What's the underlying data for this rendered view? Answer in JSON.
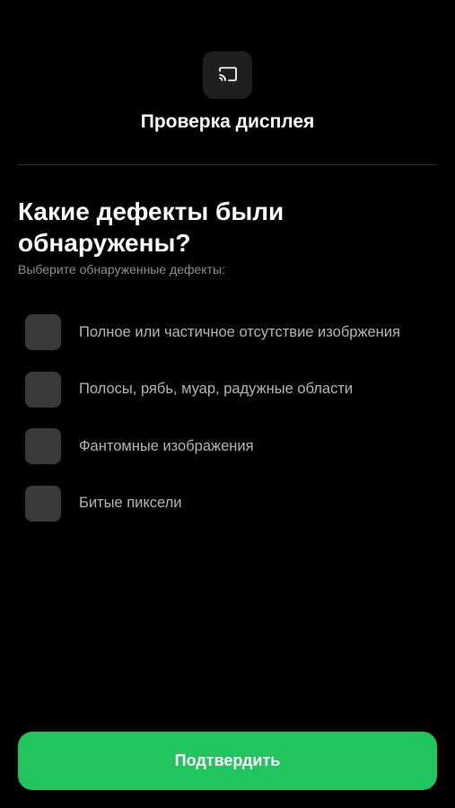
{
  "header": {
    "icon": "cast-screen-icon",
    "title": "Проверка дисплея"
  },
  "question": {
    "title": "Какие дефекты были обнаружены?",
    "subtitle": "Выберите обнаруженные дефекты:"
  },
  "options": [
    {
      "label": "Полное или частичное отсутствие изобржения",
      "checked": false
    },
    {
      "label": "Полосы, рябь, муар, радужные области",
      "checked": false
    },
    {
      "label": "Фантомные изображения",
      "checked": false
    },
    {
      "label": "Битые пиксели",
      "checked": false
    }
  ],
  "footer": {
    "confirm_label": "Подтвердить"
  },
  "colors": {
    "background": "#000000",
    "accent": "#21c45d",
    "checkbox": "#3a3a3a",
    "icon_tile": "#1f1f1f"
  }
}
